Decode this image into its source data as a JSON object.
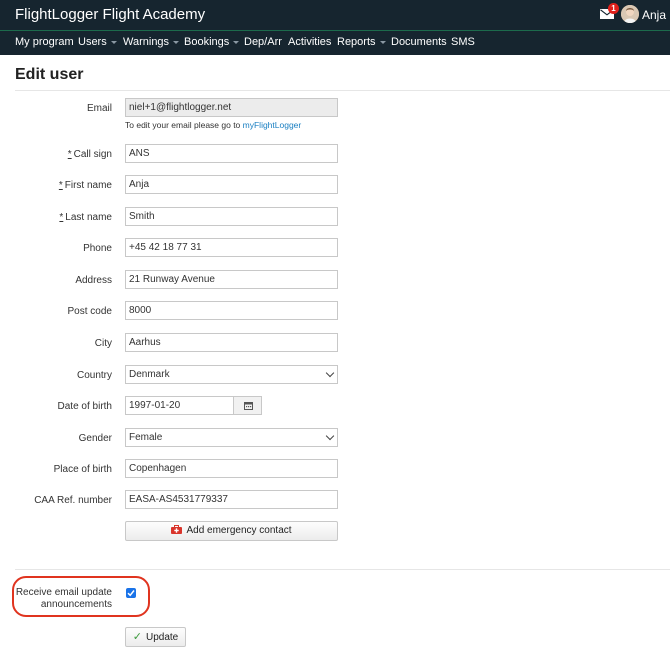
{
  "header": {
    "brand": "FlightLogger Flight Academy",
    "message_count": "1",
    "user_name": "Anja"
  },
  "nav": {
    "items": [
      {
        "label": "My program",
        "dropdown": false
      },
      {
        "label": "Users",
        "dropdown": true
      },
      {
        "label": "Warnings",
        "dropdown": true
      },
      {
        "label": "Bookings",
        "dropdown": true
      },
      {
        "label": "Dep/Arr",
        "dropdown": false
      },
      {
        "label": "Activities",
        "dropdown": false
      },
      {
        "label": "Reports",
        "dropdown": true
      },
      {
        "label": "Documents",
        "dropdown": false
      },
      {
        "label": "SMS",
        "dropdown": false
      }
    ]
  },
  "page": {
    "title": "Edit user"
  },
  "form": {
    "email": {
      "label": "Email",
      "value": "niel+1@flightlogger.net"
    },
    "email_hint": {
      "text": "To edit your email please go to ",
      "link": "myFlightLogger"
    },
    "required_mark": "*",
    "call_sign": {
      "label": "Call sign",
      "value": "ANS"
    },
    "first_name": {
      "label": "First name",
      "value": "Anja"
    },
    "last_name": {
      "label": "Last name",
      "value": "Smith"
    },
    "phone": {
      "label": "Phone",
      "value": "+45 42 18 77 31"
    },
    "address": {
      "label": "Address",
      "value": "21 Runway Avenue"
    },
    "post_code": {
      "label": "Post code",
      "value": "8000"
    },
    "city": {
      "label": "City",
      "value": "Aarhus"
    },
    "country": {
      "label": "Country",
      "value": "Denmark"
    },
    "date_of_birth": {
      "label": "Date of birth",
      "value": "1997-01-20"
    },
    "gender": {
      "label": "Gender",
      "value": "Female"
    },
    "place_of_birth": {
      "label": "Place of birth",
      "value": "Copenhagen"
    },
    "caa_ref": {
      "label": "CAA Ref. number",
      "value": "EASA-AS4531779337"
    },
    "emergency_button": "Add emergency contact",
    "email_updates": {
      "label_line1": "Receive email update",
      "label_line2": "announcements",
      "checked": true
    },
    "update_button": "Update"
  },
  "colors": {
    "header_bg": "#16252f",
    "accent_green": "#1c6b4c",
    "link": "#1a7fc2",
    "highlight_ring": "#e0341f",
    "checkbox": "#1a73e8",
    "badge": "#e0201b"
  }
}
